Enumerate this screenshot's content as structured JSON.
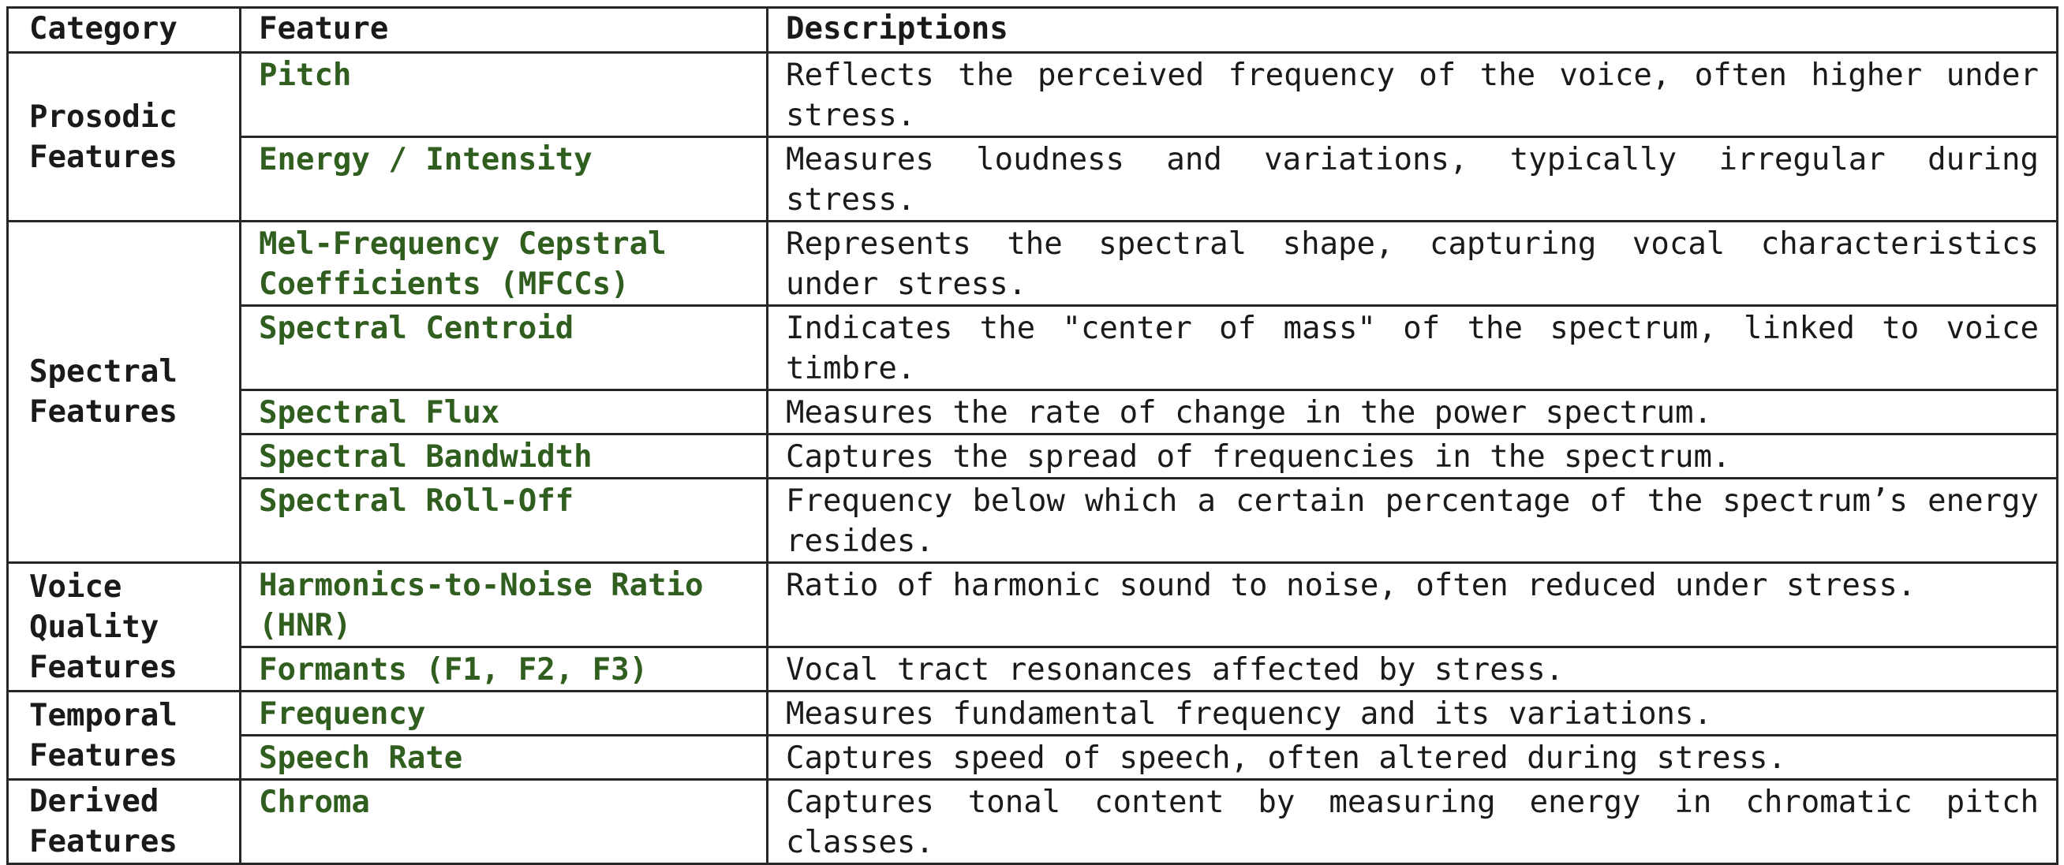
{
  "table": {
    "headers": {
      "category": "Category",
      "feature": "Feature",
      "description": "Descriptions"
    },
    "groups": [
      {
        "category": "Prosodic Features",
        "rows": [
          {
            "feature": "Pitch",
            "description": "Reflects the perceived frequency of the voice, often higher under stress."
          },
          {
            "feature": "Energy / Intensity",
            "description": "Measures loudness and variations, typically irregular during stress."
          }
        ]
      },
      {
        "category": "Spectral Features",
        "rows": [
          {
            "feature": "Mel-Frequency Cepstral Coefficients (MFCCs)",
            "description": "Represents the spectral shape, capturing vocal characteristics under stress."
          },
          {
            "feature": "Spectral Centroid",
            "description": "Indicates the \"center of mass\" of the spectrum, linked to voice timbre."
          },
          {
            "feature": "Spectral Flux",
            "description": "Measures the rate of change in the power spectrum."
          },
          {
            "feature": "Spectral Bandwidth",
            "description": "Captures the spread of frequencies in the spectrum."
          },
          {
            "feature": "Spectral Roll-Off",
            "description": "Frequency below which a certain percentage of the spectrum’s energy resides."
          }
        ]
      },
      {
        "category": "Voice Quality Features",
        "rows": [
          {
            "feature": "Harmonics-to-Noise Ratio (HNR)",
            "description": "Ratio of harmonic sound to noise, often reduced under stress."
          },
          {
            "feature": "Formants (F1, F2, F3)",
            "description": "Vocal tract resonances affected by stress."
          }
        ]
      },
      {
        "category": "Temporal Features",
        "rows": [
          {
            "feature": "Frequency",
            "description": "Measures fundamental frequency and its variations."
          },
          {
            "feature": "Speech Rate",
            "description": "Captures speed of speech, often altered during stress."
          }
        ]
      },
      {
        "category": "Derived Features",
        "rows": [
          {
            "feature": "Chroma",
            "description": "Captures tonal content by measuring energy in chromatic pitch classes."
          }
        ]
      }
    ]
  },
  "colors": {
    "feature_text": "#2f5e1f",
    "body_text": "#1a1a1a",
    "border": "#262626"
  }
}
